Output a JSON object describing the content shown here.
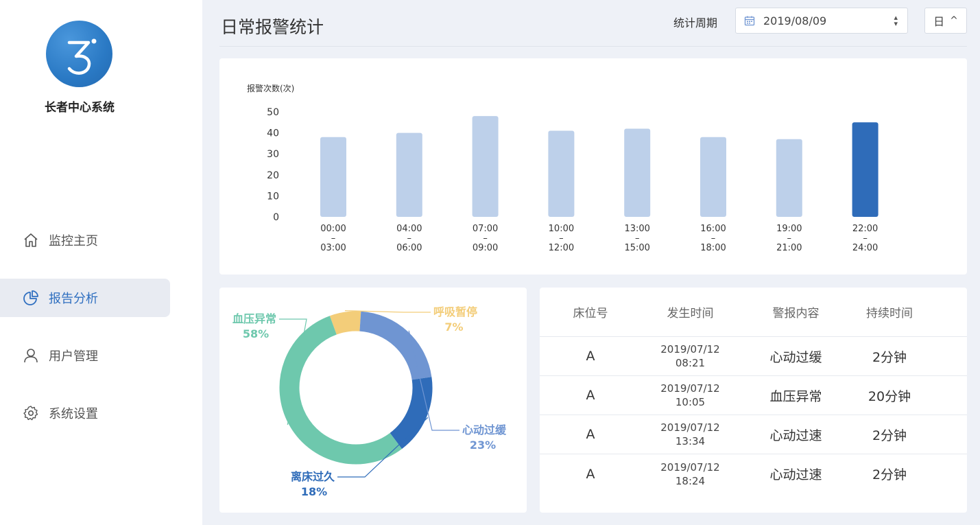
{
  "brand": {
    "name": "长者中心系统"
  },
  "sidebar": {
    "items": [
      {
        "label": "监控主页",
        "icon": "home-icon",
        "active": false
      },
      {
        "label": "报告分析",
        "icon": "pie-chart-icon",
        "active": true
      },
      {
        "label": "用户管理",
        "icon": "user-icon",
        "active": false
      },
      {
        "label": "系统设置",
        "icon": "gear-icon",
        "active": false
      }
    ]
  },
  "header": {
    "title": "日常报警统计",
    "period_label": "统计周期",
    "date_value": "2019/08/09",
    "unit_value": "日",
    "unit_caret": "^"
  },
  "chart_data": {
    "type": "bar",
    "ylabel": "报警次数(次)",
    "ylim": [
      0,
      50
    ],
    "yticks": [
      0,
      10,
      20,
      30,
      40,
      50
    ],
    "categories": [
      [
        "00:00",
        "–",
        "03:00"
      ],
      [
        "04:00",
        "–",
        "06:00"
      ],
      [
        "07:00",
        "–",
        "09:00"
      ],
      [
        "10:00",
        "–",
        "12:00"
      ],
      [
        "13:00",
        "–",
        "15:00"
      ],
      [
        "16:00",
        "–",
        "18:00"
      ],
      [
        "19:00",
        "–",
        "21:00"
      ],
      [
        "22:00",
        "–",
        "24:00"
      ]
    ],
    "values": [
      38,
      40,
      48,
      41,
      42,
      38,
      37,
      45
    ],
    "highlight_index": 7,
    "colors": {
      "bar": "#bdd0ea",
      "highlight": "#2f6cb9"
    },
    "grid": false
  },
  "donut": {
    "type": "pie",
    "slices": [
      {
        "label": "血压异常",
        "percent": "58%",
        "value": 58,
        "color": "#6ec8ad"
      },
      {
        "label": "呼吸暂停",
        "percent": "7%",
        "value": 7,
        "color": "#f3cd79"
      },
      {
        "label": "心动过缓",
        "percent": "23%",
        "value": 23,
        "color": "#6f95d2"
      },
      {
        "label": "离床过久",
        "percent": "18%",
        "value": 18,
        "color": "#2f6cb9"
      }
    ]
  },
  "table": {
    "headers": [
      "床位号",
      "发生时间",
      "警报内容",
      "持续时间"
    ],
    "rows": [
      {
        "bed": "A",
        "date": "2019/07/12",
        "time": "08:21",
        "content": "心动过缓",
        "duration": "2分钟"
      },
      {
        "bed": "A",
        "date": "2019/07/12",
        "time": "10:05",
        "content": "血压异常",
        "duration": "20分钟"
      },
      {
        "bed": "A",
        "date": "2019/07/12",
        "time": "13:34",
        "content": "心动过速",
        "duration": "2分钟"
      },
      {
        "bed": "A",
        "date": "2019/07/12",
        "time": "18:24",
        "content": "心动过速",
        "duration": "2分钟"
      }
    ]
  }
}
